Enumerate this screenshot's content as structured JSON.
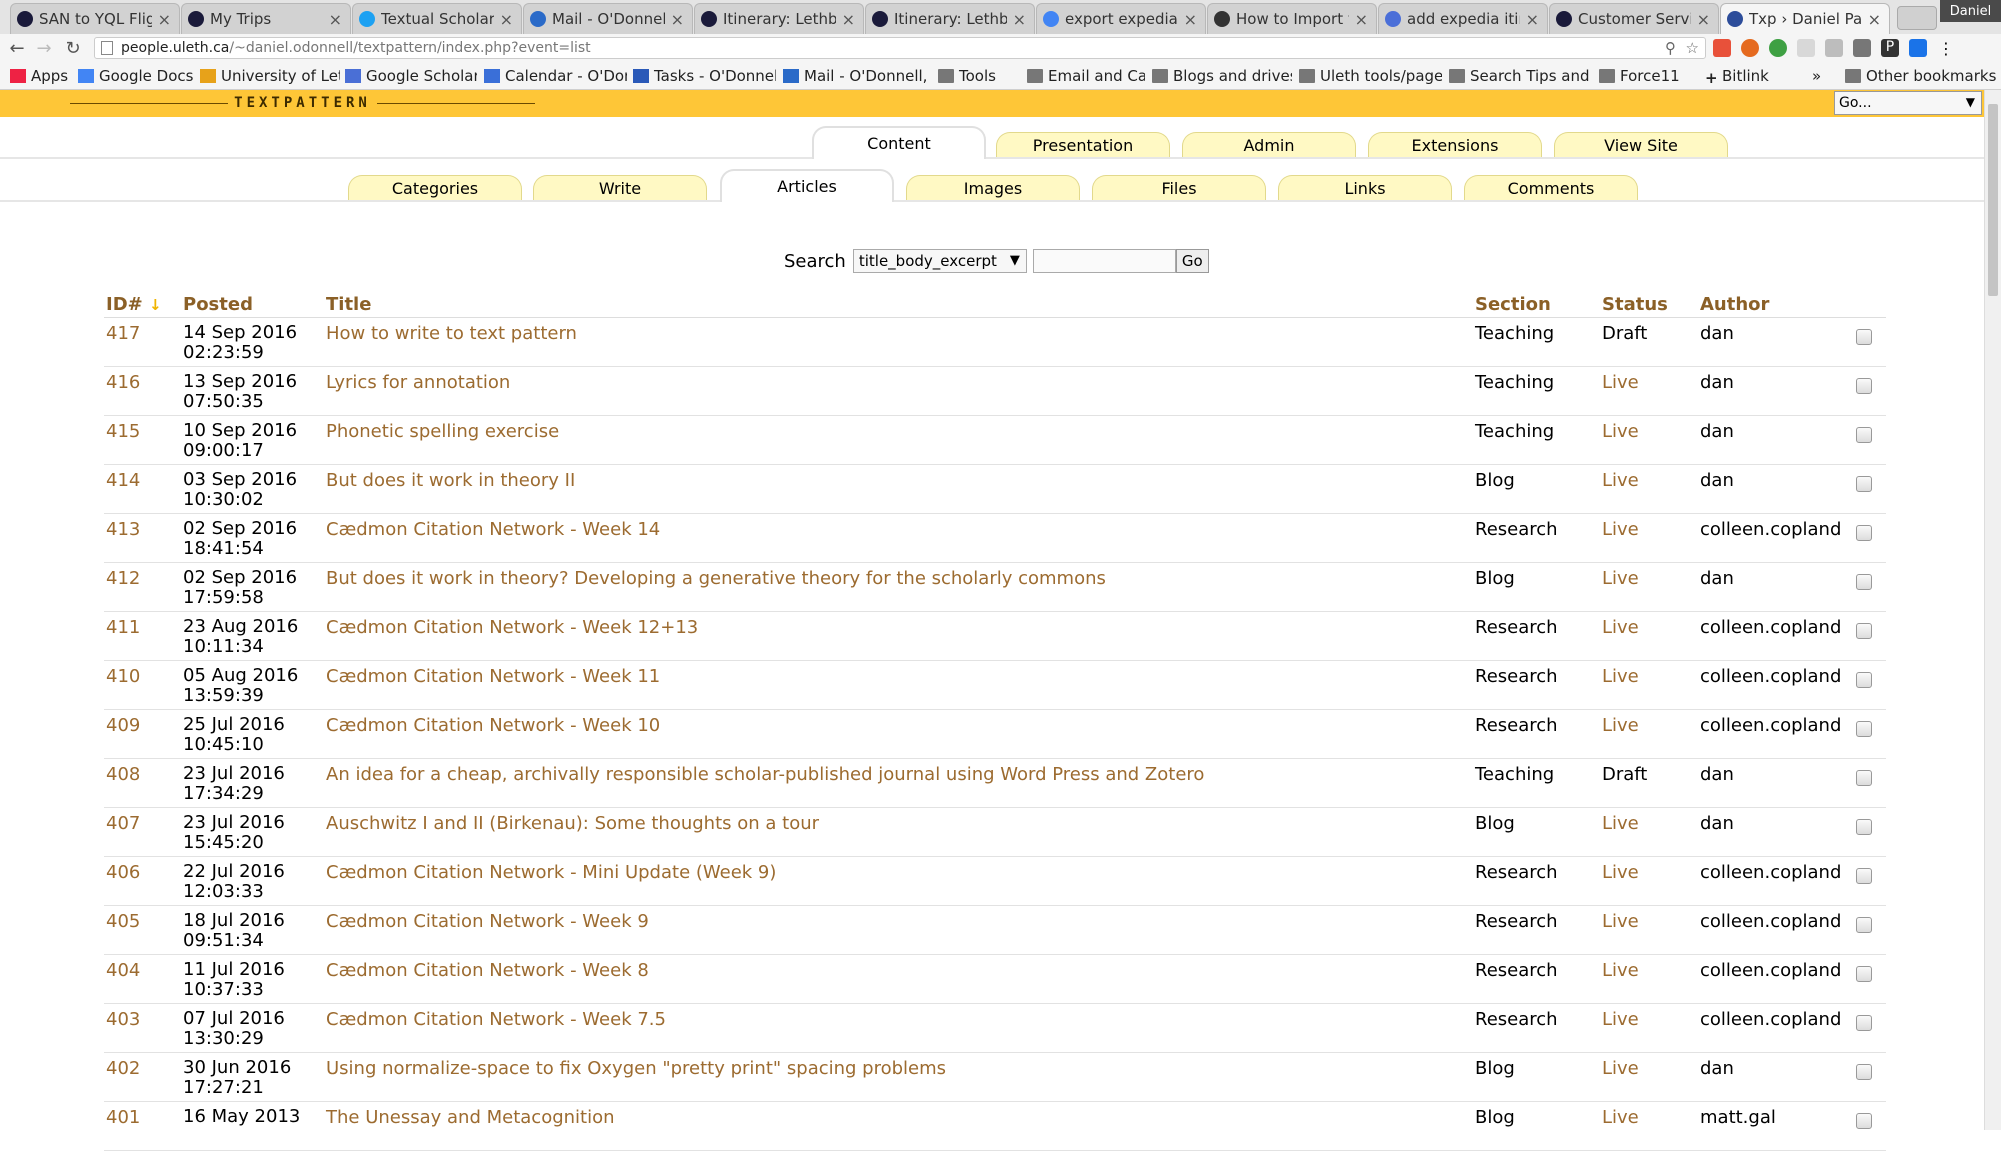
{
  "browser": {
    "tabs": [
      {
        "title": "SAN to YQL Flig",
        "icon": "#1a1a3a"
      },
      {
        "title": "My Trips",
        "icon": "#1a1a3a"
      },
      {
        "title": "Textual Scholar",
        "icon": "#1da1f2"
      },
      {
        "title": "Mail - O'Donnell",
        "icon": "#2a6ac8"
      },
      {
        "title": "Itinerary: Lethb",
        "icon": "#1a1a3a"
      },
      {
        "title": "Itinerary: Lethb",
        "icon": "#1a1a3a"
      },
      {
        "title": "export expedia",
        "icon": "#4285f4"
      },
      {
        "title": "How to Import y",
        "icon": "#333333"
      },
      {
        "title": "add expedia itin",
        "icon": "#4b6fd8"
      },
      {
        "title": "Customer Servic",
        "icon": "#1a1a3a"
      },
      {
        "title": "Txp › Daniel Pau",
        "icon": "#2d4d9a",
        "active": true
      }
    ],
    "profile_name": "Daniel",
    "url_host": "people.uleth.ca",
    "url_path": "/~daniel.odonnell/textpattern/index.php?event=list",
    "bookmarks": [
      {
        "label": "Apps",
        "icon": "apps-icon"
      },
      {
        "label": "Google Docs",
        "icon": "docs-icon"
      },
      {
        "label": "University of Leth",
        "icon": "sunrise-icon"
      },
      {
        "label": "Google Scholar",
        "icon": "scholar-icon"
      },
      {
        "label": "Calendar - O'Don",
        "icon": "calendar-icon"
      },
      {
        "label": "Tasks - O'Donnell",
        "icon": "check-icon"
      },
      {
        "label": "Mail - O'Donnell,",
        "icon": "mail-icon"
      },
      {
        "label": "Tools",
        "icon": "folder-icon"
      },
      {
        "label": "Email and Calend",
        "icon": "folder-icon"
      },
      {
        "label": "Blogs and drives",
        "icon": "folder-icon"
      },
      {
        "label": "Uleth tools/page",
        "icon": "folder-icon"
      },
      {
        "label": "Search Tips and e",
        "icon": "folder-icon"
      },
      {
        "label": "Force11",
        "icon": "folder-icon"
      },
      {
        "label": "Bitlink",
        "icon": "plus-icon"
      }
    ],
    "bookmarks_overflow": "»",
    "other_bookmarks": "Other bookmarks"
  },
  "txp": {
    "logo": "TEXTPATTERN",
    "jump_select": "Go...",
    "primary_tabs": [
      "Content",
      "Presentation",
      "Admin",
      "Extensions",
      "View Site"
    ],
    "primary_active": "Content",
    "secondary_tabs": [
      "Categories",
      "Write",
      "Articles",
      "Images",
      "Files",
      "Links",
      "Comments"
    ],
    "secondary_active": "Articles",
    "search": {
      "label": "Search",
      "method": "title_body_excerpt",
      "button": "Go"
    },
    "columns": {
      "id": "ID#",
      "posted": "Posted",
      "title": "Title",
      "section": "Section",
      "status": "Status",
      "author": "Author"
    },
    "articles": [
      {
        "id": "417",
        "date": "14 Sep 2016",
        "time": "02:23:59",
        "title": "How to write to text pattern",
        "section": "Teaching",
        "status": "Draft",
        "author": "dan"
      },
      {
        "id": "416",
        "date": "13 Sep 2016",
        "time": "07:50:35",
        "title": "Lyrics for annotation",
        "section": "Teaching",
        "status": "Live",
        "author": "dan"
      },
      {
        "id": "415",
        "date": "10 Sep 2016",
        "time": "09:00:17",
        "title": "Phonetic spelling exercise",
        "section": "Teaching",
        "status": "Live",
        "author": "dan"
      },
      {
        "id": "414",
        "date": "03 Sep 2016",
        "time": "10:30:02",
        "title": "But does it work in theory II",
        "section": "Blog",
        "status": "Live",
        "author": "dan"
      },
      {
        "id": "413",
        "date": "02 Sep 2016",
        "time": "18:41:54",
        "title": "Cædmon Citation Network - Week 14",
        "section": "Research",
        "status": "Live",
        "author": "colleen.copland"
      },
      {
        "id": "412",
        "date": "02 Sep 2016",
        "time": "17:59:58",
        "title": "But does it work in theory? Developing a generative theory for the scholarly commons",
        "section": "Blog",
        "status": "Live",
        "author": "dan"
      },
      {
        "id": "411",
        "date": "23 Aug 2016",
        "time": "10:11:34",
        "title": "Cædmon Citation Network - Week 12+13",
        "section": "Research",
        "status": "Live",
        "author": "colleen.copland"
      },
      {
        "id": "410",
        "date": "05 Aug 2016",
        "time": "13:59:39",
        "title": "Cædmon Citation Network - Week 11",
        "section": "Research",
        "status": "Live",
        "author": "colleen.copland"
      },
      {
        "id": "409",
        "date": "25 Jul 2016",
        "time": "10:45:10",
        "title": "Cædmon Citation Network - Week 10",
        "section": "Research",
        "status": "Live",
        "author": "colleen.copland"
      },
      {
        "id": "408",
        "date": "23 Jul 2016",
        "time": "17:34:29",
        "title": "An idea for a cheap, archivally responsible scholar-published journal using Word Press and Zotero",
        "section": "Teaching",
        "status": "Draft",
        "author": "dan"
      },
      {
        "id": "407",
        "date": "23 Jul 2016",
        "time": "15:45:20",
        "title": "Auschwitz I and II (Birkenau): Some thoughts on a tour",
        "section": "Blog",
        "status": "Live",
        "author": "dan"
      },
      {
        "id": "406",
        "date": "22 Jul 2016",
        "time": "12:03:33",
        "title": "Cædmon Citation Network - Mini Update (Week 9)",
        "section": "Research",
        "status": "Live",
        "author": "colleen.copland"
      },
      {
        "id": "405",
        "date": "18 Jul 2016",
        "time": "09:51:34",
        "title": "Cædmon Citation Network - Week 9",
        "section": "Research",
        "status": "Live",
        "author": "colleen.copland"
      },
      {
        "id": "404",
        "date": "11 Jul 2016",
        "time": "10:37:33",
        "title": "Cædmon Citation Network - Week 8",
        "section": "Research",
        "status": "Live",
        "author": "colleen.copland"
      },
      {
        "id": "403",
        "date": "07 Jul 2016",
        "time": "13:30:29",
        "title": "Cædmon Citation Network - Week 7.5",
        "section": "Research",
        "status": "Live",
        "author": "colleen.copland"
      },
      {
        "id": "402",
        "date": "30 Jun 2016",
        "time": "17:27:21",
        "title": "Using normalize-space to fix Oxygen \"pretty print\" spacing problems",
        "section": "Blog",
        "status": "Live",
        "author": "dan"
      },
      {
        "id": "401",
        "date": "16 May 2013",
        "time": "",
        "title": "The Unessay and Metacognition",
        "section": "Blog",
        "status": "Live",
        "author": "matt.gal"
      }
    ]
  }
}
